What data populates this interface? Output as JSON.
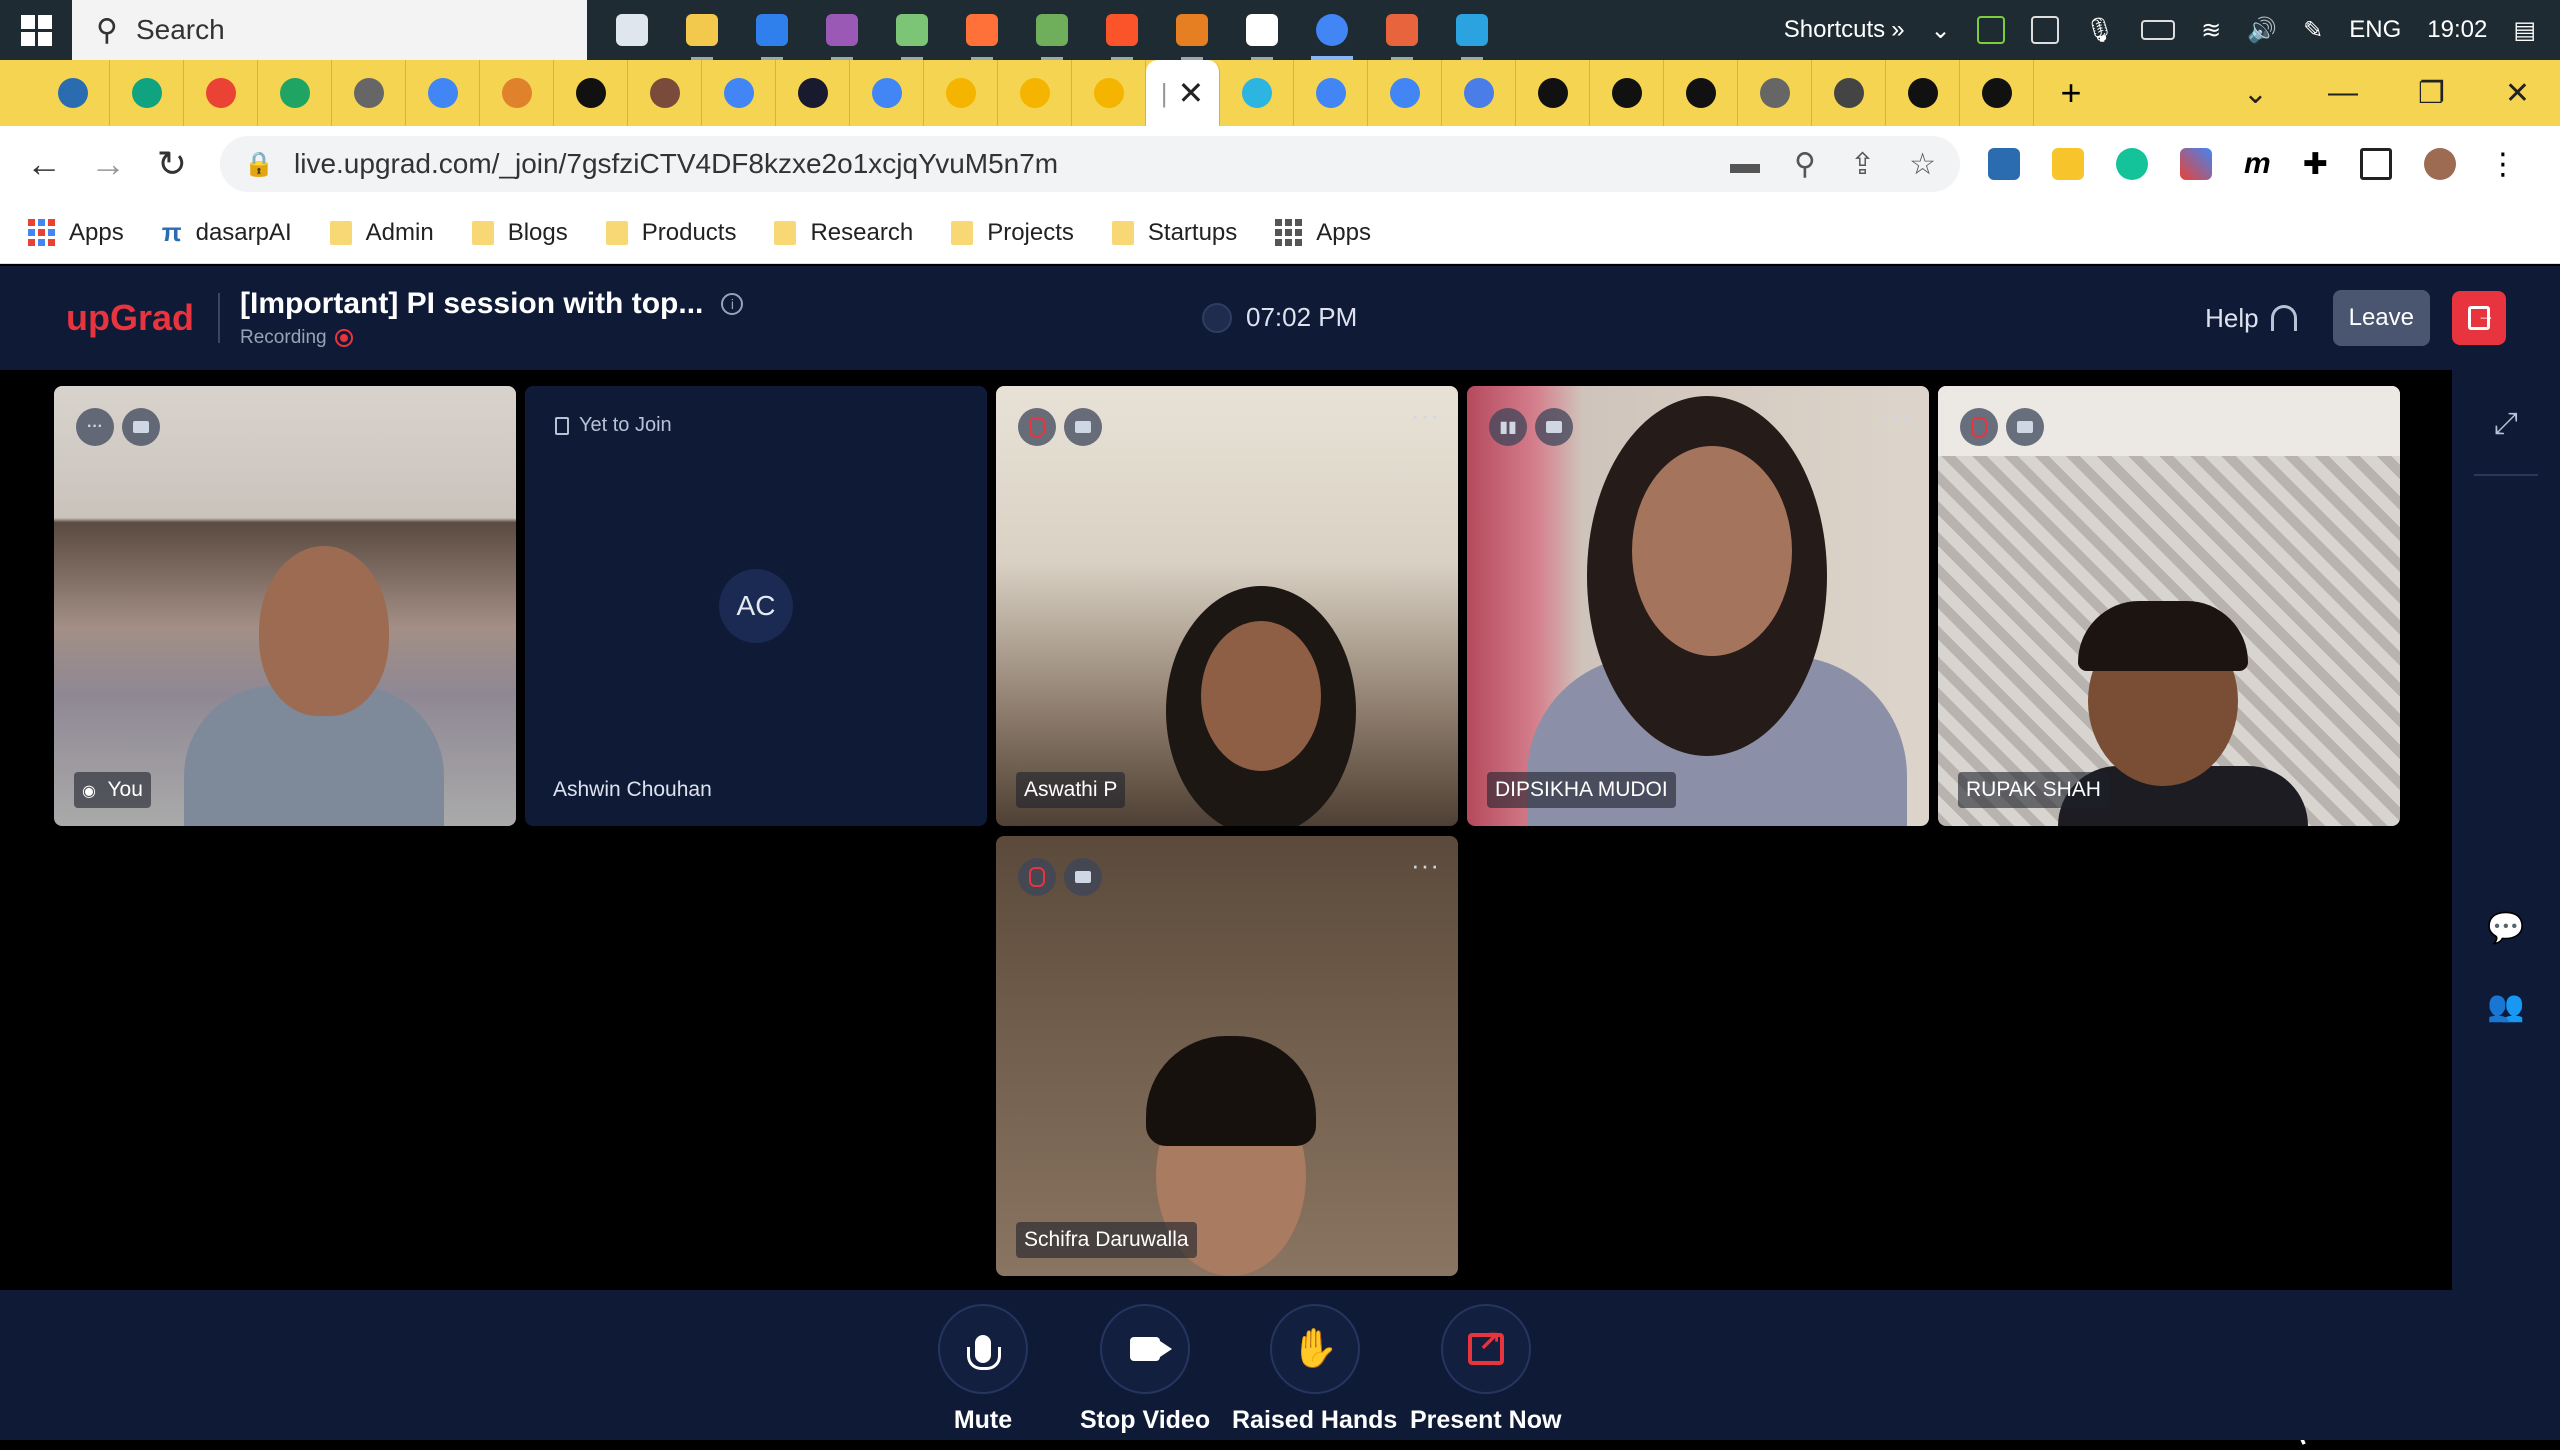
{
  "taskbar": {
    "search_placeholder": "Search",
    "shortcuts_label": "Shortcuts",
    "language": "ENG",
    "time": "19:02",
    "apps": [
      {
        "name": "task-view",
        "color": "#dfe6ee"
      },
      {
        "name": "file-explorer",
        "color": "#f2c94c"
      },
      {
        "name": "vscode",
        "color": "#2f80ed"
      },
      {
        "name": "github-desktop",
        "color": "#9b59b6"
      },
      {
        "name": "notepad",
        "color": "#7cc576"
      },
      {
        "name": "firefox",
        "color": "#ff7139"
      },
      {
        "name": "app-green",
        "color": "#6fae5a"
      },
      {
        "name": "brave",
        "color": "#fb542b"
      },
      {
        "name": "grammarly-desktop",
        "color": "#e67e22"
      },
      {
        "name": "whiteboard",
        "color": "#ffffff"
      },
      {
        "name": "chrome",
        "color": "#4285f4"
      },
      {
        "name": "powerpoint",
        "color": "#e8643c"
      },
      {
        "name": "telegram",
        "color": "#2aa3e0"
      }
    ]
  },
  "browser": {
    "tabs": [
      {
        "fav": "#2b6cb0"
      },
      {
        "fav": "#10a37f"
      },
      {
        "fav": "#ea4335"
      },
      {
        "fav": "#1fa463"
      },
      {
        "fav": "#666666"
      },
      {
        "fav": "#4285f4"
      },
      {
        "fav": "#e0812b"
      },
      {
        "fav": "#111111"
      },
      {
        "fav": "#7a4a3a"
      },
      {
        "fav": "#4285f4"
      },
      {
        "fav": "#1a1a2e"
      },
      {
        "fav": "#4285f4"
      },
      {
        "fav": "#f4b400"
      },
      {
        "fav": "#f4b400"
      },
      {
        "fav": "#f4b400"
      }
    ],
    "tabs_after": [
      {
        "fav": "#2bb5e0"
      },
      {
        "fav": "#4285f4"
      },
      {
        "fav": "#4285f4"
      },
      {
        "fav": "#4a7de8"
      },
      {
        "fav": "#111111"
      },
      {
        "fav": "#111111"
      },
      {
        "fav": "#111111"
      },
      {
        "fav": "#666666"
      },
      {
        "fav": "#444444"
      },
      {
        "fav": "#111111"
      },
      {
        "fav": "#111111"
      }
    ],
    "url": "live.upgrad.com/_join/7gsfziCTV4DF8kzxe2o1xcjqYvuM5n7m"
  },
  "bookmarks": [
    {
      "label": "Apps",
      "type": "apps-color"
    },
    {
      "label": "dasarpAI",
      "type": "logo"
    },
    {
      "label": "Admin",
      "type": "folder"
    },
    {
      "label": "Blogs",
      "type": "folder"
    },
    {
      "label": "Products",
      "type": "folder"
    },
    {
      "label": "Research",
      "type": "folder"
    },
    {
      "label": "Projects",
      "type": "folder"
    },
    {
      "label": "Startups",
      "type": "folder"
    },
    {
      "label": "Apps",
      "type": "apps"
    }
  ],
  "app": {
    "brand": "upGrad",
    "session_title": "[Important] PI session with top...",
    "recording_label": "Recording",
    "clock": "07:02 PM",
    "help_label": "Help",
    "leave_label": "Leave"
  },
  "participants": {
    "you": {
      "name": "You"
    },
    "ashwin": {
      "status": "Yet to Join",
      "initials": "AC",
      "name": "Ashwin Chouhan"
    },
    "aswathi": {
      "name": "Aswathi P"
    },
    "dipsikha": {
      "name": "DIPSIKHA MUDOI"
    },
    "rupak": {
      "name": "RUPAK SHAH"
    },
    "schifra": {
      "name": "Schifra Daruwalla"
    }
  },
  "controls": {
    "mute": "Mute",
    "stop_video": "Stop Video",
    "raised_hands": "Raised Hands",
    "present_now": "Present Now"
  },
  "colors": {
    "accent": "#e7343f",
    "app_bg": "#0e1a36",
    "tabstrip": "#f5d451"
  }
}
